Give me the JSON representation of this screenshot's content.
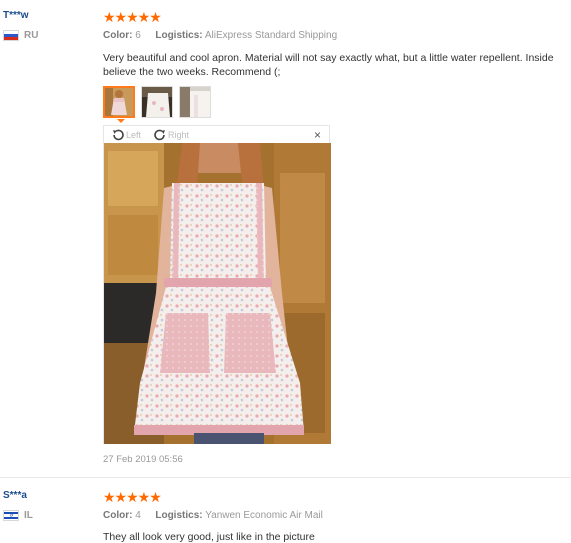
{
  "reviews": [
    {
      "user": "T***w",
      "country_code": "RU",
      "rating": "★★★★★",
      "color_label": "Color:",
      "color_value": "6",
      "logistics_label": "Logistics:",
      "logistics_value": "AliExpress Standard Shipping",
      "text_line1": "Very beautiful and cool apron. Material will not say exactly what, but a little water repellent. Inside",
      "text_line2": "believe the two weeks. Recommend (;",
      "viewer": {
        "left_label": "Left",
        "right_label": "Right",
        "close": "×"
      },
      "date": "27 Feb 2019 05:56"
    },
    {
      "user": "S***a",
      "country_code": "IL",
      "rating": "★★★★★",
      "color_label": "Color:",
      "color_value": "4",
      "logistics_label": "Logistics:",
      "logistics_value": "Yanwen Economic Air Mail",
      "text_line1": "They all look very good, just like in the picture"
    }
  ],
  "colors": {
    "user": "#1b4c8f",
    "stars": "#ff6a00",
    "active_thumb": "#ff7a1a"
  }
}
